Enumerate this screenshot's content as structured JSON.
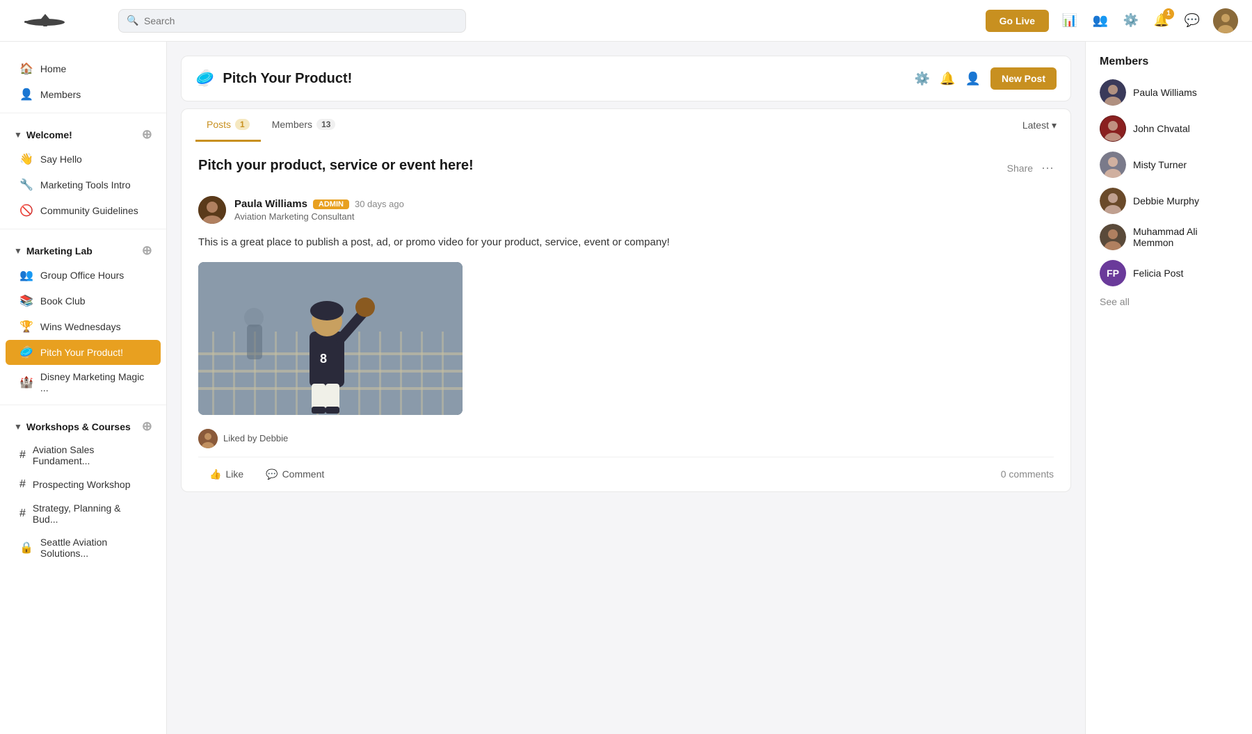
{
  "topnav": {
    "search_placeholder": "Search",
    "golive_label": "Go Live",
    "notification_count": "1"
  },
  "sidebar": {
    "nav_home": "Home",
    "nav_members": "Members",
    "sections": [
      {
        "id": "welcome",
        "label": "Welcome!",
        "items": [
          {
            "id": "say-hello",
            "icon": "👋",
            "label": "Say Hello"
          },
          {
            "id": "marketing-tools",
            "icon": "🔧",
            "label": "Marketing Tools Intro"
          },
          {
            "id": "community-guidelines",
            "icon": "🚫",
            "label": "Community Guidelines"
          }
        ]
      },
      {
        "id": "marketing-lab",
        "label": "Marketing Lab",
        "items": [
          {
            "id": "group-office-hours",
            "icon": "👥",
            "label": "Group Office Hours"
          },
          {
            "id": "book-club",
            "icon": "📚",
            "label": "Book Club"
          },
          {
            "id": "wins-wednesdays",
            "icon": "🏆",
            "label": "Wins Wednesdays"
          },
          {
            "id": "pitch-your-product",
            "icon": "🥏",
            "label": "Pitch Your Product!",
            "active": true
          },
          {
            "id": "disney-marketing",
            "icon": "🏰",
            "label": "Disney Marketing Magic ..."
          }
        ]
      },
      {
        "id": "workshops-courses",
        "label": "Workshops & Courses",
        "items": [
          {
            "id": "aviation-sales",
            "icon": "#",
            "label": "Aviation Sales Fundament..."
          },
          {
            "id": "prospecting-workshop",
            "icon": "#",
            "label": "Prospecting Workshop"
          },
          {
            "id": "strategy-planning",
            "icon": "#",
            "label": "Strategy, Planning & Bud..."
          },
          {
            "id": "seattle-aviation",
            "icon": "🔒",
            "label": "Seattle Aviation Solutions..."
          }
        ]
      }
    ]
  },
  "post_section": {
    "channel_icon": "🥏",
    "channel_title": "Pitch Your Product!",
    "tabs": [
      {
        "id": "posts",
        "label": "Posts",
        "badge": "1",
        "active": true
      },
      {
        "id": "members",
        "label": "Members",
        "badge": "13",
        "active": false
      }
    ],
    "sort_label": "Latest",
    "new_post_label": "New Post",
    "post": {
      "title": "Pitch your product, service or event here!",
      "author_name": "Paula Williams",
      "author_role": "Aviation Marketing Consultant",
      "author_badge": "ADMIN",
      "time_ago": "30 days ago",
      "body": "This is a great place to publish a post, ad, or promo video for your product, service, event or company!",
      "liked_by": "Liked by Debbie",
      "comments_count": "0 comments",
      "share_label": "Share",
      "like_label": "Like",
      "comment_label": "Comment"
    }
  },
  "members_panel": {
    "title": "Members",
    "members": [
      {
        "id": "paula-williams",
        "name": "Paula Williams",
        "color": "dark-suit"
      },
      {
        "id": "john-chvatal",
        "name": "John Chvatal",
        "color": "red"
      },
      {
        "id": "misty-turner",
        "name": "Misty Turner",
        "color": "gray"
      },
      {
        "id": "debbie-murphy",
        "name": "Debbie Murphy",
        "color": "brown"
      },
      {
        "id": "muhammad-ali",
        "name": "Muhammad Ali Memmon",
        "color": "tan"
      },
      {
        "id": "felicia-post",
        "name": "Felicia Post",
        "initials": "FP",
        "color": "purple"
      }
    ],
    "see_all_label": "See all"
  }
}
